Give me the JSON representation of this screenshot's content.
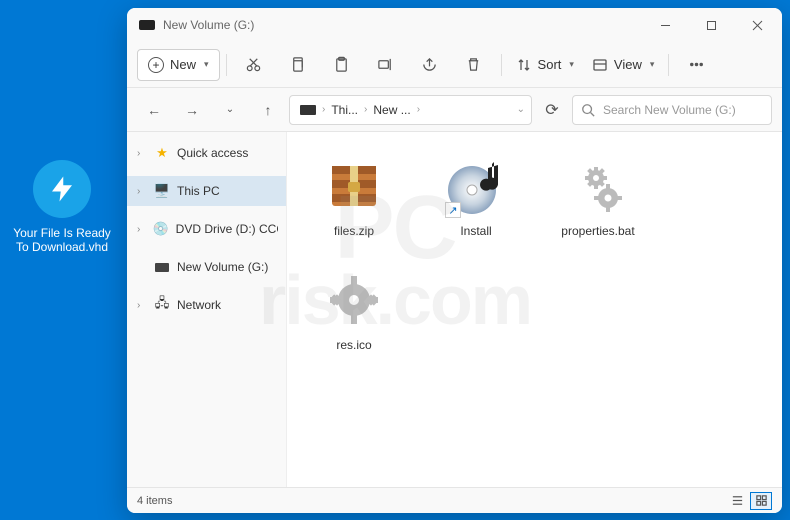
{
  "desktop": {
    "file_label": "Your File Is Ready To Download.vhd"
  },
  "window": {
    "title": "New Volume (G:)"
  },
  "toolbar": {
    "new_label": "New",
    "sort_label": "Sort",
    "view_label": "View"
  },
  "breadcrumb": {
    "items": [
      "Thi...",
      "New ..."
    ]
  },
  "search": {
    "placeholder": "Search New Volume (G:)"
  },
  "sidebar": {
    "items": [
      {
        "label": "Quick access",
        "icon": "star",
        "active": false
      },
      {
        "label": "This PC",
        "icon": "monitor",
        "active": true
      },
      {
        "label": "DVD Drive (D:) CCCC",
        "icon": "disc",
        "active": false
      },
      {
        "label": "New Volume (G:)",
        "icon": "drive",
        "active": false
      },
      {
        "label": "Network",
        "icon": "network",
        "active": false
      }
    ]
  },
  "files": [
    {
      "name": "files.zip",
      "kind": "archive",
      "shortcut": false
    },
    {
      "name": "Install",
      "kind": "disc-music",
      "shortcut": true
    },
    {
      "name": "properties.bat",
      "kind": "gear",
      "shortcut": false
    },
    {
      "name": "res.ico",
      "kind": "gear",
      "shortcut": false
    }
  ],
  "status": {
    "text": "4 items"
  },
  "watermark": {
    "line1": "PC",
    "line2": "risk.com"
  }
}
